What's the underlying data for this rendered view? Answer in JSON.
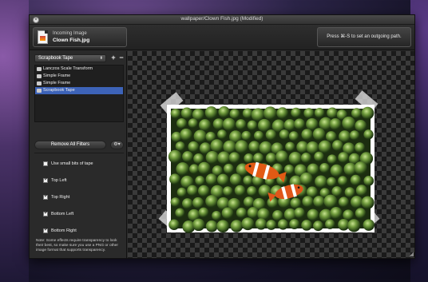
{
  "window": {
    "title": "wallpaper/Clown Fish.jpg (Modified)"
  },
  "incoming": {
    "label": "Incoming Image",
    "filename": "Clown Fish.jpg"
  },
  "outgoing": {
    "hint": "Press ⌘-S to set an outgoing path."
  },
  "filters": {
    "selected": "Scrapbook Tape",
    "add_label": "+",
    "remove_label": "−",
    "items": [
      {
        "label": "Lanczos Scale Transform",
        "selected": false
      },
      {
        "label": "Simple Frame",
        "selected": false
      },
      {
        "label": "Simple Frame",
        "selected": false
      },
      {
        "label": "Scrapbook Tape",
        "selected": true
      }
    ],
    "remove_all_label": "Remove All Filters"
  },
  "options": [
    {
      "label": "Use small bits of tape",
      "checked": false
    },
    {
      "label": "Top Left",
      "checked": true
    },
    {
      "label": "Top Right",
      "checked": true
    },
    {
      "label": "Bottom Left",
      "checked": true
    },
    {
      "label": "Bottom Right",
      "checked": true
    }
  ],
  "note": "Note: Some effects require transparency to look their best, so make sure you use a PNG or other image format that supports transparency.",
  "icons": {
    "close": "close-icon",
    "file": "image-file-icon",
    "gear": "gear-icon",
    "resize": "resize-grip-icon"
  },
  "colors": {
    "selection": "#3d63b8",
    "window_bg": "#2b2b2b",
    "tape": "#e8e8e8",
    "photo_border": "#ffffff"
  }
}
